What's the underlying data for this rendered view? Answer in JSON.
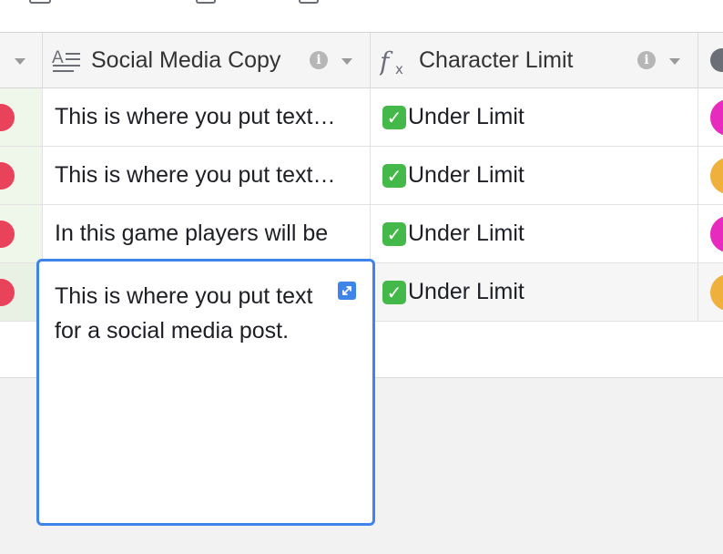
{
  "colors": {
    "accent": "#3f84e9",
    "check_green": "#45b84a",
    "status_red": "#e8435a",
    "pill_pink": "#e82bbf",
    "pill_orange": "#f0b03c"
  },
  "columns": [
    {
      "label": "Social Media Copy",
      "icon": "long-text-icon"
    },
    {
      "label": "Character Limit",
      "icon": "formula-fx-icon"
    }
  ],
  "rows": [
    {
      "copy": "This is where you put text…",
      "limit": "Under Limit",
      "pill": "pink"
    },
    {
      "copy": "This is where you put text…",
      "limit": "Under Limit",
      "pill": "orange"
    },
    {
      "copy": "In this game players will be",
      "limit": "Under Limit",
      "pill": "pink"
    },
    {
      "copy": "",
      "limit": "Under Limit",
      "pill": "orange"
    }
  ],
  "editor": {
    "text": "This is where you put text for a social media post."
  }
}
